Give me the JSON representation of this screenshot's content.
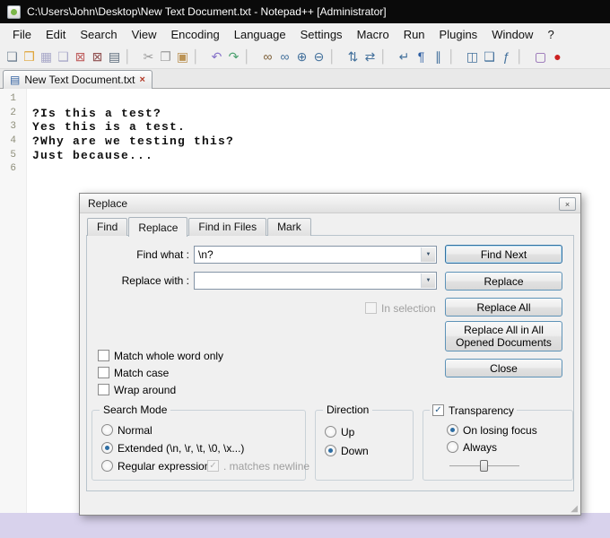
{
  "colors": {
    "titlebar_bg": "#0a0a0a",
    "desktop_strip": "#d8d2ec",
    "accent_blue": "#2d6da3",
    "show_all_chars_blue": "#2e5fa3",
    "record_red": "#cc2020"
  },
  "glyphs": {
    "check": "✓",
    "dropdown": "▼",
    "close": "×",
    "doc": "▤",
    "grip": "◢"
  },
  "titlebar": {
    "title": "C:\\Users\\John\\Desktop\\New Text Document.txt - Notepad++ [Administrator]"
  },
  "menu": {
    "items": [
      {
        "name": "menu-file",
        "label": "File"
      },
      {
        "name": "menu-edit",
        "label": "Edit"
      },
      {
        "name": "menu-search",
        "label": "Search"
      },
      {
        "name": "menu-view",
        "label": "View"
      },
      {
        "name": "menu-encoding",
        "label": "Encoding"
      },
      {
        "name": "menu-language",
        "label": "Language"
      },
      {
        "name": "menu-settings",
        "label": "Settings"
      },
      {
        "name": "menu-macro",
        "label": "Macro"
      },
      {
        "name": "menu-run",
        "label": "Run"
      },
      {
        "name": "menu-plugins",
        "label": "Plugins"
      },
      {
        "name": "menu-window",
        "label": "Window"
      },
      {
        "name": "menu-help",
        "label": "?"
      }
    ]
  },
  "toolbar": {
    "icons": [
      {
        "name": "new-file-icon",
        "glyph": "❏",
        "color": "#6d7f91",
        "interactable": "true"
      },
      {
        "name": "open-folder-icon",
        "glyph": "❒",
        "color": "#dfa437",
        "interactable": "true"
      },
      {
        "name": "save-icon",
        "glyph": "▦",
        "color": "#a9a9c9",
        "interactable": "true"
      },
      {
        "name": "save-all-icon",
        "glyph": "❑",
        "color": "#a9a9c9",
        "interactable": "true"
      },
      {
        "name": "close-file-icon",
        "glyph": "⊠",
        "color": "#bf5f5f",
        "interactable": "true"
      },
      {
        "name": "close-all-icon",
        "glyph": "⊠",
        "color": "#8f4f4f",
        "interactable": "true"
      },
      {
        "name": "print-icon",
        "glyph": "▤",
        "color": "#5a6a7a",
        "interactable": "true"
      },
      {
        "name": "toolbar-separator",
        "glyph": "▏",
        "color": "#c8c8c8",
        "interactable": "false"
      },
      {
        "name": "cut-icon",
        "glyph": "✂",
        "color": "#9a9a9a",
        "interactable": "true"
      },
      {
        "name": "copy-icon",
        "glyph": "❐",
        "color": "#9a9a9a",
        "interactable": "true"
      },
      {
        "name": "paste-icon",
        "glyph": "▣",
        "color": "#bb9355",
        "interactable": "true"
      },
      {
        "name": "toolbar-separator",
        "glyph": "▏",
        "color": "#c8c8c8",
        "interactable": "false"
      },
      {
        "name": "undo-icon",
        "glyph": "↶",
        "color": "#8571c9",
        "interactable": "true"
      },
      {
        "name": "redo-icon",
        "glyph": "↷",
        "color": "#4aa06e",
        "interactable": "true"
      },
      {
        "name": "toolbar-separator",
        "glyph": "▏",
        "color": "#c8c8c8",
        "interactable": "false"
      },
      {
        "name": "find-icon",
        "glyph": "∞",
        "color": "#7a5c34",
        "interactable": "true"
      },
      {
        "name": "replace-icon",
        "glyph": "∞",
        "color": "#44719c",
        "interactable": "true"
      },
      {
        "name": "zoom-in-icon",
        "glyph": "⊕",
        "color": "#44719c",
        "interactable": "true"
      },
      {
        "name": "zoom-out-icon",
        "glyph": "⊖",
        "color": "#44719c",
        "interactable": "true"
      },
      {
        "name": "toolbar-separator",
        "glyph": "▏",
        "color": "#c8c8c8",
        "interactable": "false"
      },
      {
        "name": "sync-vertical-scroll-icon",
        "glyph": "⇅",
        "color": "#44719c",
        "interactable": "true"
      },
      {
        "name": "sync-horizontal-scroll-icon",
        "glyph": "⇄",
        "color": "#44719c",
        "interactable": "true"
      },
      {
        "name": "toolbar-separator",
        "glyph": "▏",
        "color": "#c8c8c8",
        "interactable": "false"
      },
      {
        "name": "word-wrap-icon",
        "glyph": "↵",
        "color": "#44719c",
        "interactable": "true"
      },
      {
        "name": "show-all-characters-icon",
        "glyph": "¶",
        "color": "#2e5fa3",
        "interactable": "true"
      },
      {
        "name": "indent-guide-icon",
        "glyph": "∥",
        "color": "#44719c",
        "interactable": "true"
      },
      {
        "name": "toolbar-separator",
        "glyph": "▏",
        "color": "#c8c8c8",
        "interactable": "false"
      },
      {
        "name": "doc-map-icon",
        "glyph": "◫",
        "color": "#44719c",
        "interactable": "true"
      },
      {
        "name": "doc-switcher-icon",
        "glyph": "❑",
        "color": "#44719c",
        "interactable": "true"
      },
      {
        "name": "function-list-icon",
        "glyph": "ƒ",
        "color": "#44719c",
        "interactable": "true"
      },
      {
        "name": "toolbar-separator",
        "glyph": "▏",
        "color": "#c8c8c8",
        "interactable": "false"
      },
      {
        "name": "monitor-icon",
        "glyph": "▢",
        "color": "#8a5fae",
        "interactable": "true"
      },
      {
        "name": "macro-record-icon",
        "glyph": "●",
        "color": "#cc2020",
        "interactable": "true"
      }
    ]
  },
  "tabbar": {
    "active_tab": "New Text Document.txt"
  },
  "editor": {
    "lines": [
      {
        "num": "1",
        "text": ""
      },
      {
        "num": "2",
        "text": "?Is this a test?"
      },
      {
        "num": "3",
        "text": "Yes this is a test."
      },
      {
        "num": "4",
        "text": "?Why are we testing this?"
      },
      {
        "num": "5",
        "text": "Just because..."
      },
      {
        "num": "6",
        "text": ""
      }
    ]
  },
  "dialog": {
    "title": "Replace",
    "tabs": [
      {
        "label": "Find"
      },
      {
        "label": "Replace",
        "active": true
      },
      {
        "label": "Find in Files"
      },
      {
        "label": "Mark"
      }
    ],
    "find_what": {
      "label": "Find what :",
      "value": "\\n?"
    },
    "replace_with": {
      "label": "Replace with :",
      "value": ""
    },
    "in_selection": {
      "label": "In selection",
      "checked": false,
      "disabled": true
    },
    "buttons": {
      "find_next": "Find Next",
      "replace": "Replace",
      "replace_all": "Replace All",
      "replace_all_open_docs": "Replace All in All Opened Documents",
      "close": "Close"
    },
    "checkboxes": {
      "match_whole_word": {
        "label": "Match whole word only",
        "checked": false
      },
      "match_case": {
        "label": "Match case",
        "checked": false
      },
      "wrap_around": {
        "label": "Wrap around",
        "checked": false
      }
    },
    "search_mode": {
      "title": "Search Mode",
      "normal": {
        "label": "Normal",
        "selected": false
      },
      "extended": {
        "label": "Extended (\\n, \\r, \\t, \\0, \\x...)",
        "selected": true
      },
      "regex": {
        "label": "Regular expression",
        "selected": false
      },
      "matches_newline": {
        "label": ". matches newline",
        "checked": true,
        "disabled": true
      }
    },
    "direction": {
      "title": "Direction",
      "up": {
        "label": "Up",
        "selected": false
      },
      "down": {
        "label": "Down",
        "selected": true
      }
    },
    "transparency": {
      "label": "Transparency",
      "checked": true,
      "on_losing_focus": {
        "label": "On losing focus",
        "selected": true
      },
      "always": {
        "label": "Always",
        "selected": false
      },
      "slider_value": 45
    }
  }
}
